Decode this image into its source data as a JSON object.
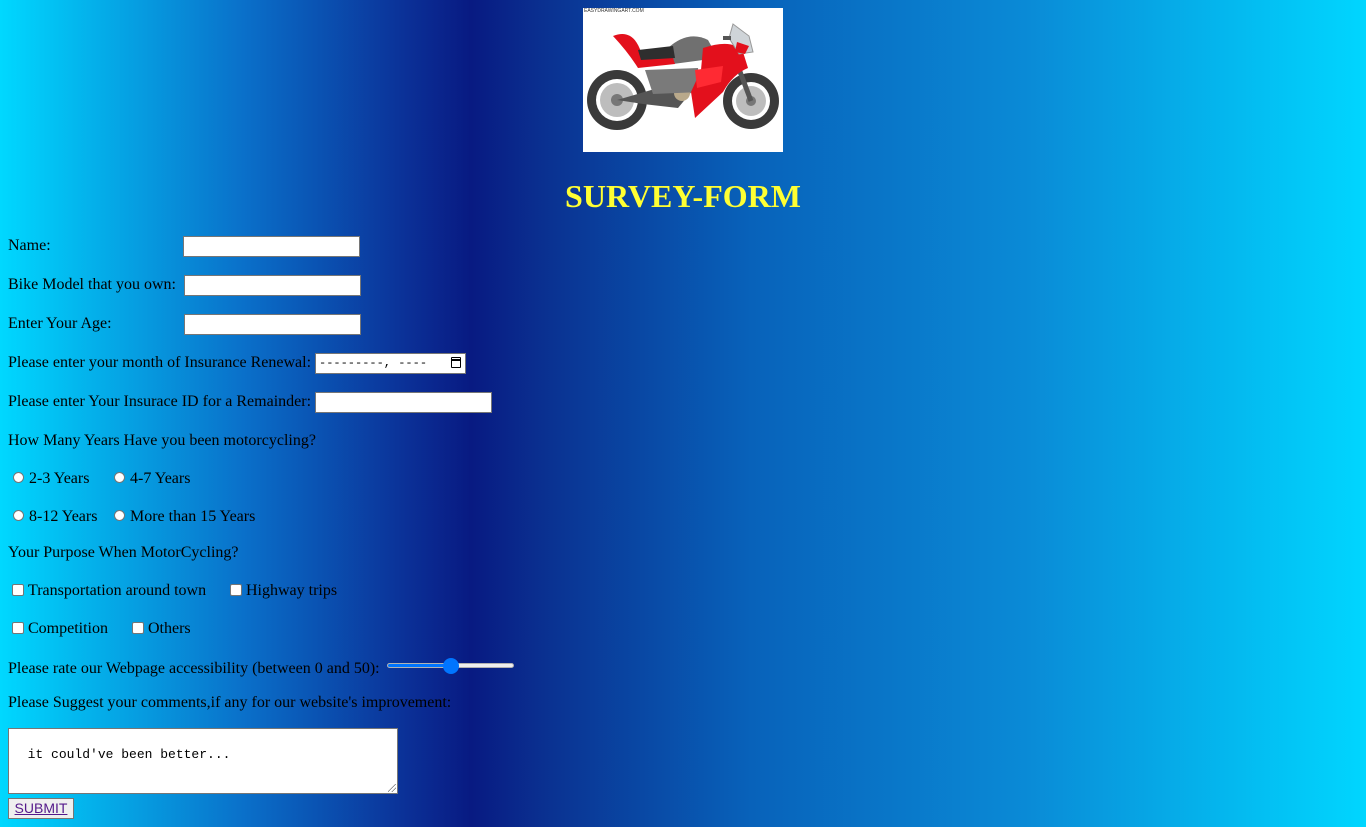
{
  "logo": {
    "credit": "EASYDRAWINGART.COM"
  },
  "title": "SURVEY-FORM",
  "form": {
    "name_label": "Name:",
    "name_value": "",
    "bike_label": "Bike Model that you own:",
    "bike_value": "",
    "age_label": "Enter Your Age:",
    "age_value": "",
    "renewal_label": "Please enter your month of Insurance Renewal:",
    "renewal_value": "---------, ----",
    "insurance_label": "Please enter Your Insurace ID for a Remainder:",
    "insurance_value": "",
    "years_question": "How Many Years Have you been motorcycling?",
    "years_options": [
      "2-3 Years",
      "4-7 Years",
      "8-12 Years",
      "More than 15 Years"
    ],
    "purpose_question": "Your Purpose When MotorCycling?",
    "purpose_options": [
      "Transportation around town",
      "Highway trips",
      "Competition",
      "Others"
    ],
    "rating_label": "Please rate our Webpage accessibility (between 0 and 50):",
    "rating": {
      "min": 0,
      "max": 50,
      "value": 25
    },
    "comments_label": "Please Suggest your comments,if any for our website's improvement:",
    "comments_value": "it could've been better...",
    "submit_label": "SUBMIT"
  },
  "colors": {
    "title": "#ffff33",
    "accent": "#0075ff",
    "link": "#551a8b"
  }
}
